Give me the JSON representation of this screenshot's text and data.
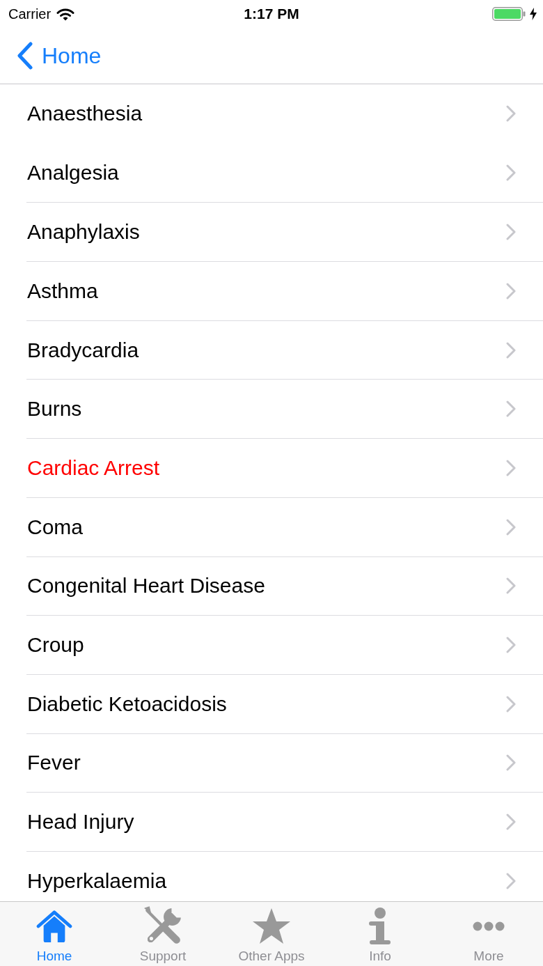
{
  "status_bar": {
    "carrier": "Carrier",
    "time": "1:17 PM"
  },
  "nav_bar": {
    "back_label": "Home"
  },
  "items": [
    {
      "label": "Anaesthesia",
      "color": "#000000"
    },
    {
      "label": "Analgesia",
      "color": "#000000"
    },
    {
      "label": "Anaphylaxis",
      "color": "#000000"
    },
    {
      "label": "Asthma",
      "color": "#000000"
    },
    {
      "label": "Bradycardia",
      "color": "#000000"
    },
    {
      "label": "Burns",
      "color": "#000000"
    },
    {
      "label": "Cardiac Arrest",
      "color": "#ff0000"
    },
    {
      "label": "Coma",
      "color": "#000000"
    },
    {
      "label": "Congenital Heart Disease",
      "color": "#000000"
    },
    {
      "label": "Croup",
      "color": "#000000"
    },
    {
      "label": "Diabetic Ketoacidosis",
      "color": "#000000"
    },
    {
      "label": "Fever",
      "color": "#000000"
    },
    {
      "label": "Head Injury",
      "color": "#000000"
    },
    {
      "label": "Hyperkalaemia",
      "color": "#000000"
    }
  ],
  "tab_bar": [
    {
      "label": "Home",
      "kind": "home",
      "selected": true
    },
    {
      "label": "Support",
      "kind": "tools",
      "selected": false
    },
    {
      "label": "Other Apps",
      "kind": "star",
      "selected": false
    },
    {
      "label": "Info",
      "kind": "info",
      "selected": false
    },
    {
      "label": "More",
      "kind": "more",
      "selected": false
    }
  ]
}
